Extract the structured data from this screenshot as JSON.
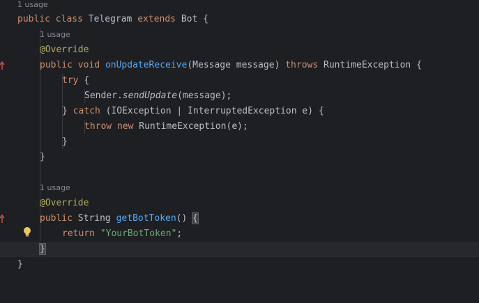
{
  "editor": {
    "usage_hint": "1 usage",
    "lines": {
      "l1": {
        "kw1": "public",
        "kw2": "class",
        "name": "Telegram",
        "kw3": "extends",
        "base": "Bot",
        "brace": "{"
      },
      "override_annotation": "@Override",
      "l3": {
        "kw1": "public",
        "kw2": "void",
        "method": "onUpdateReceive",
        "params": "(Message message)",
        "kw3": "throws",
        "exc": "RuntimeException",
        "brace": "{"
      },
      "l4": {
        "kw": "try",
        "brace": "{"
      },
      "l5": {
        "obj": "Sender.",
        "method": "sendUpdate",
        "args": "(message);"
      },
      "l6": {
        "brace": "}",
        "kw": "catch",
        "rest": "(IOException | InterruptedException e) {"
      },
      "l7": {
        "kw1": "throw",
        "kw2": "new",
        "rest": "RuntimeException(e);"
      },
      "close_brace": "}",
      "l9": {
        "kw1": "public",
        "type": "String",
        "method": "getBotToken",
        "parens": "()",
        "brace": "{"
      },
      "l10": {
        "kw": "return",
        "str": "\"YourBotToken\"",
        "semi": ";"
      }
    }
  },
  "icons": {
    "override_marker": "override-arrow-icon",
    "intention": "lightbulb-icon"
  },
  "colors": {
    "background": "#1e1f22",
    "keyword": "#cf8e6d",
    "function": "#56a8f5",
    "annotation": "#b3ae60",
    "string": "#6aab73",
    "text": "#bcbec4",
    "hint": "#868a91"
  }
}
